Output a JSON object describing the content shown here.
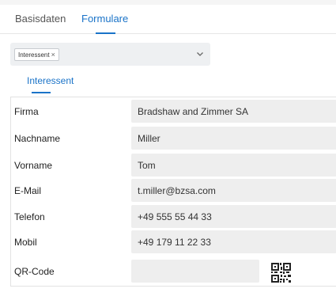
{
  "tabs": [
    {
      "label": "Basisdaten",
      "active": false
    },
    {
      "label": "Formulare",
      "active": true
    }
  ],
  "form_select": {
    "chip_label": "Interessent",
    "chip_remove": "×"
  },
  "subtab": {
    "label": "Interessent"
  },
  "fields": [
    {
      "label": "Firma",
      "value": "Bradshaw and Zimmer SA"
    },
    {
      "label": "Nachname",
      "value": "Miller"
    },
    {
      "label": "Vorname",
      "value": "Tom"
    },
    {
      "label": "E-Mail",
      "value": "t.miller@bzsa.com"
    },
    {
      "label": "Telefon",
      "value": "+49 555 55 44 33"
    },
    {
      "label": "Mobil",
      "value": "+49 179 11 22 33"
    },
    {
      "label": "QR-Code",
      "value": ""
    }
  ],
  "icons": {
    "qr": "qr-code-icon",
    "chevron": "chevron-down-icon"
  },
  "colors": {
    "accent": "#1a73c8",
    "field_bg": "#eeeeee"
  }
}
